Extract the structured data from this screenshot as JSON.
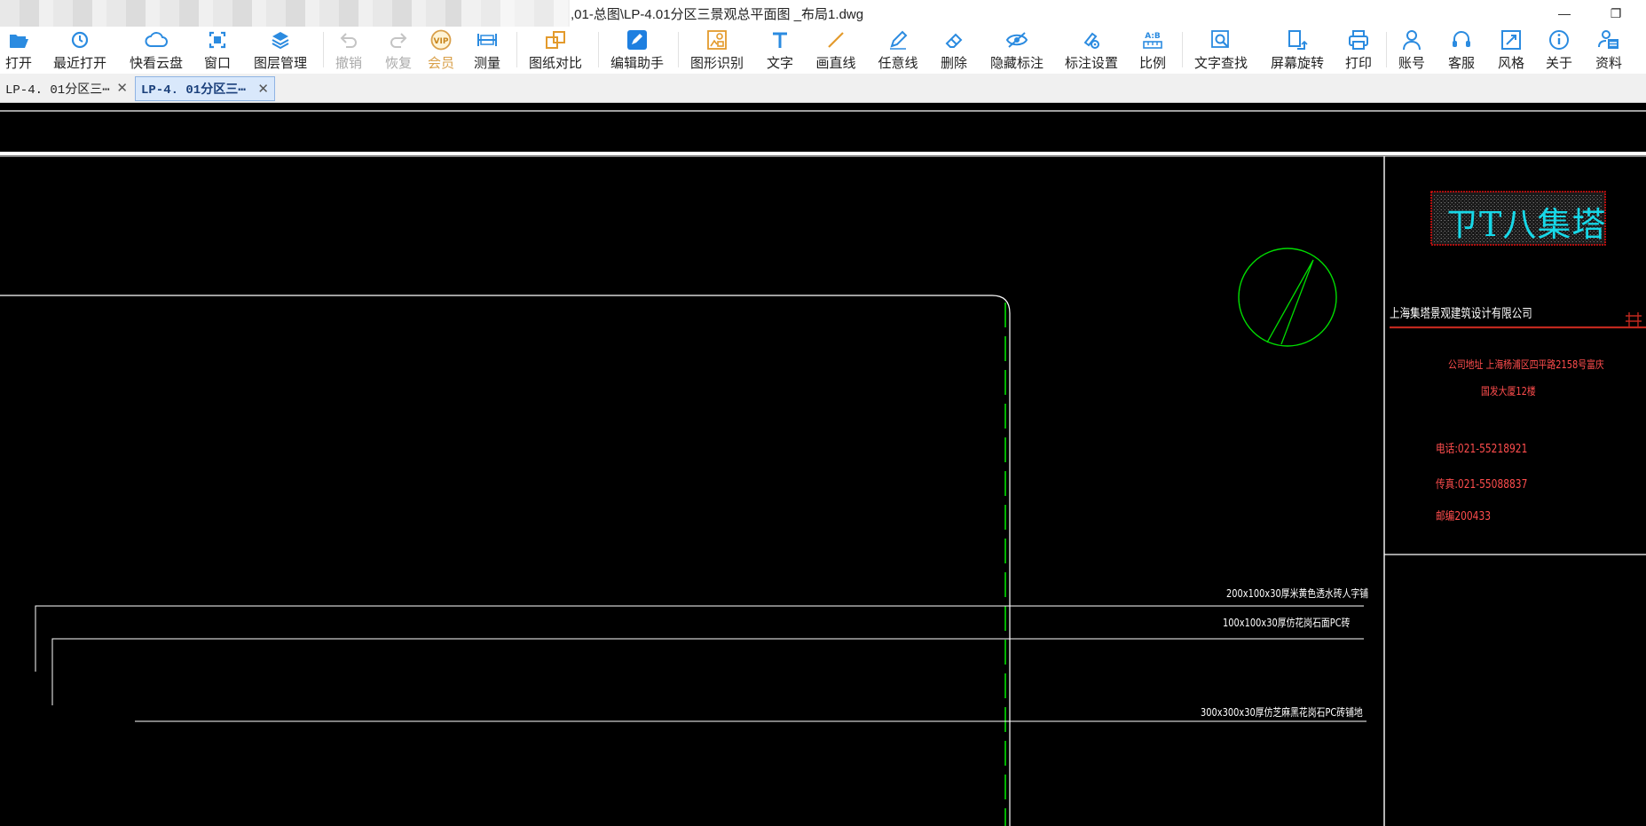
{
  "titlebar": {
    "title": ",01-总图\\LP-4.01分区三景观总平面图 _布局1.dwg",
    "minimize_icon": "minimize-icon",
    "restore_icon": "restore-icon"
  },
  "toolbar": {
    "items": [
      {
        "label": "打开",
        "icon": "folder-open-icon"
      },
      {
        "label": "最近打开",
        "icon": "history-icon"
      },
      {
        "label": "快看云盘",
        "icon": "cloud-icon"
      },
      {
        "label": "窗口",
        "icon": "window-icon"
      },
      {
        "label": "图层管理",
        "icon": "layers-icon"
      },
      {
        "label": "撤销",
        "icon": "undo-icon"
      },
      {
        "label": "恢复",
        "icon": "redo-icon"
      },
      {
        "label": "会员",
        "icon": "vip-icon",
        "badge": "VIP"
      },
      {
        "label": "测量",
        "icon": "ruler-icon"
      },
      {
        "label": "图纸对比",
        "icon": "compare-icon"
      },
      {
        "label": "编辑助手",
        "icon": "edit-assistant-icon"
      },
      {
        "label": "图形识别",
        "icon": "shape-recognition-icon"
      },
      {
        "label": "文字",
        "icon": "text-icon"
      },
      {
        "label": "画直线",
        "icon": "line-icon"
      },
      {
        "label": "任意线",
        "icon": "pen-icon"
      },
      {
        "label": "删除",
        "icon": "eraser-icon"
      },
      {
        "label": "隐藏标注",
        "icon": "eye-hide-icon"
      },
      {
        "label": "标注设置",
        "icon": "annotation-settings-icon"
      },
      {
        "label": "比例",
        "icon": "scale-icon",
        "badge": "A:B"
      },
      {
        "label": "文字查找",
        "icon": "text-search-icon"
      },
      {
        "label": "屏幕旋转",
        "icon": "rotate-screen-icon"
      },
      {
        "label": "打印",
        "icon": "printer-icon"
      },
      {
        "label": "账号",
        "icon": "user-icon"
      },
      {
        "label": "客服",
        "icon": "headset-icon"
      },
      {
        "label": "风格",
        "icon": "style-icon"
      },
      {
        "label": "关于",
        "icon": "info-icon"
      },
      {
        "label": "资料",
        "icon": "documents-icon"
      }
    ]
  },
  "tabs": [
    {
      "label": "LP-4. 01分区三⋯",
      "close": "✕",
      "active": false
    },
    {
      "label": "LP-4. 01分区三⋯",
      "close": "✕",
      "active": true
    }
  ],
  "drawing": {
    "logo_text": "ㄗT八集塔",
    "company_name": "上海集塔景观建筑设计有限公司",
    "address_line1": "公司地址 上海杨浦区四平路2158号富庆",
    "address_line2": "国发大厦12楼",
    "phone": "电话:021-55218921",
    "fax": "传真:021-55088837",
    "postcode": "邮编200433",
    "note1": "200x100x30厚米黄色透水砖人字铺",
    "note2": "100x100x30厚仿花岗石面PC砖",
    "note3": "300x300x30厚仿芝麻黑花岗石PC砖铺地",
    "colors": {
      "line_white": "#ffffff",
      "line_green": "#00ff00",
      "text_red": "#ff4d4d",
      "logo_cyan": "#17d8e8",
      "logo_border": "#e01010",
      "separator_red": "#c0281e"
    }
  }
}
